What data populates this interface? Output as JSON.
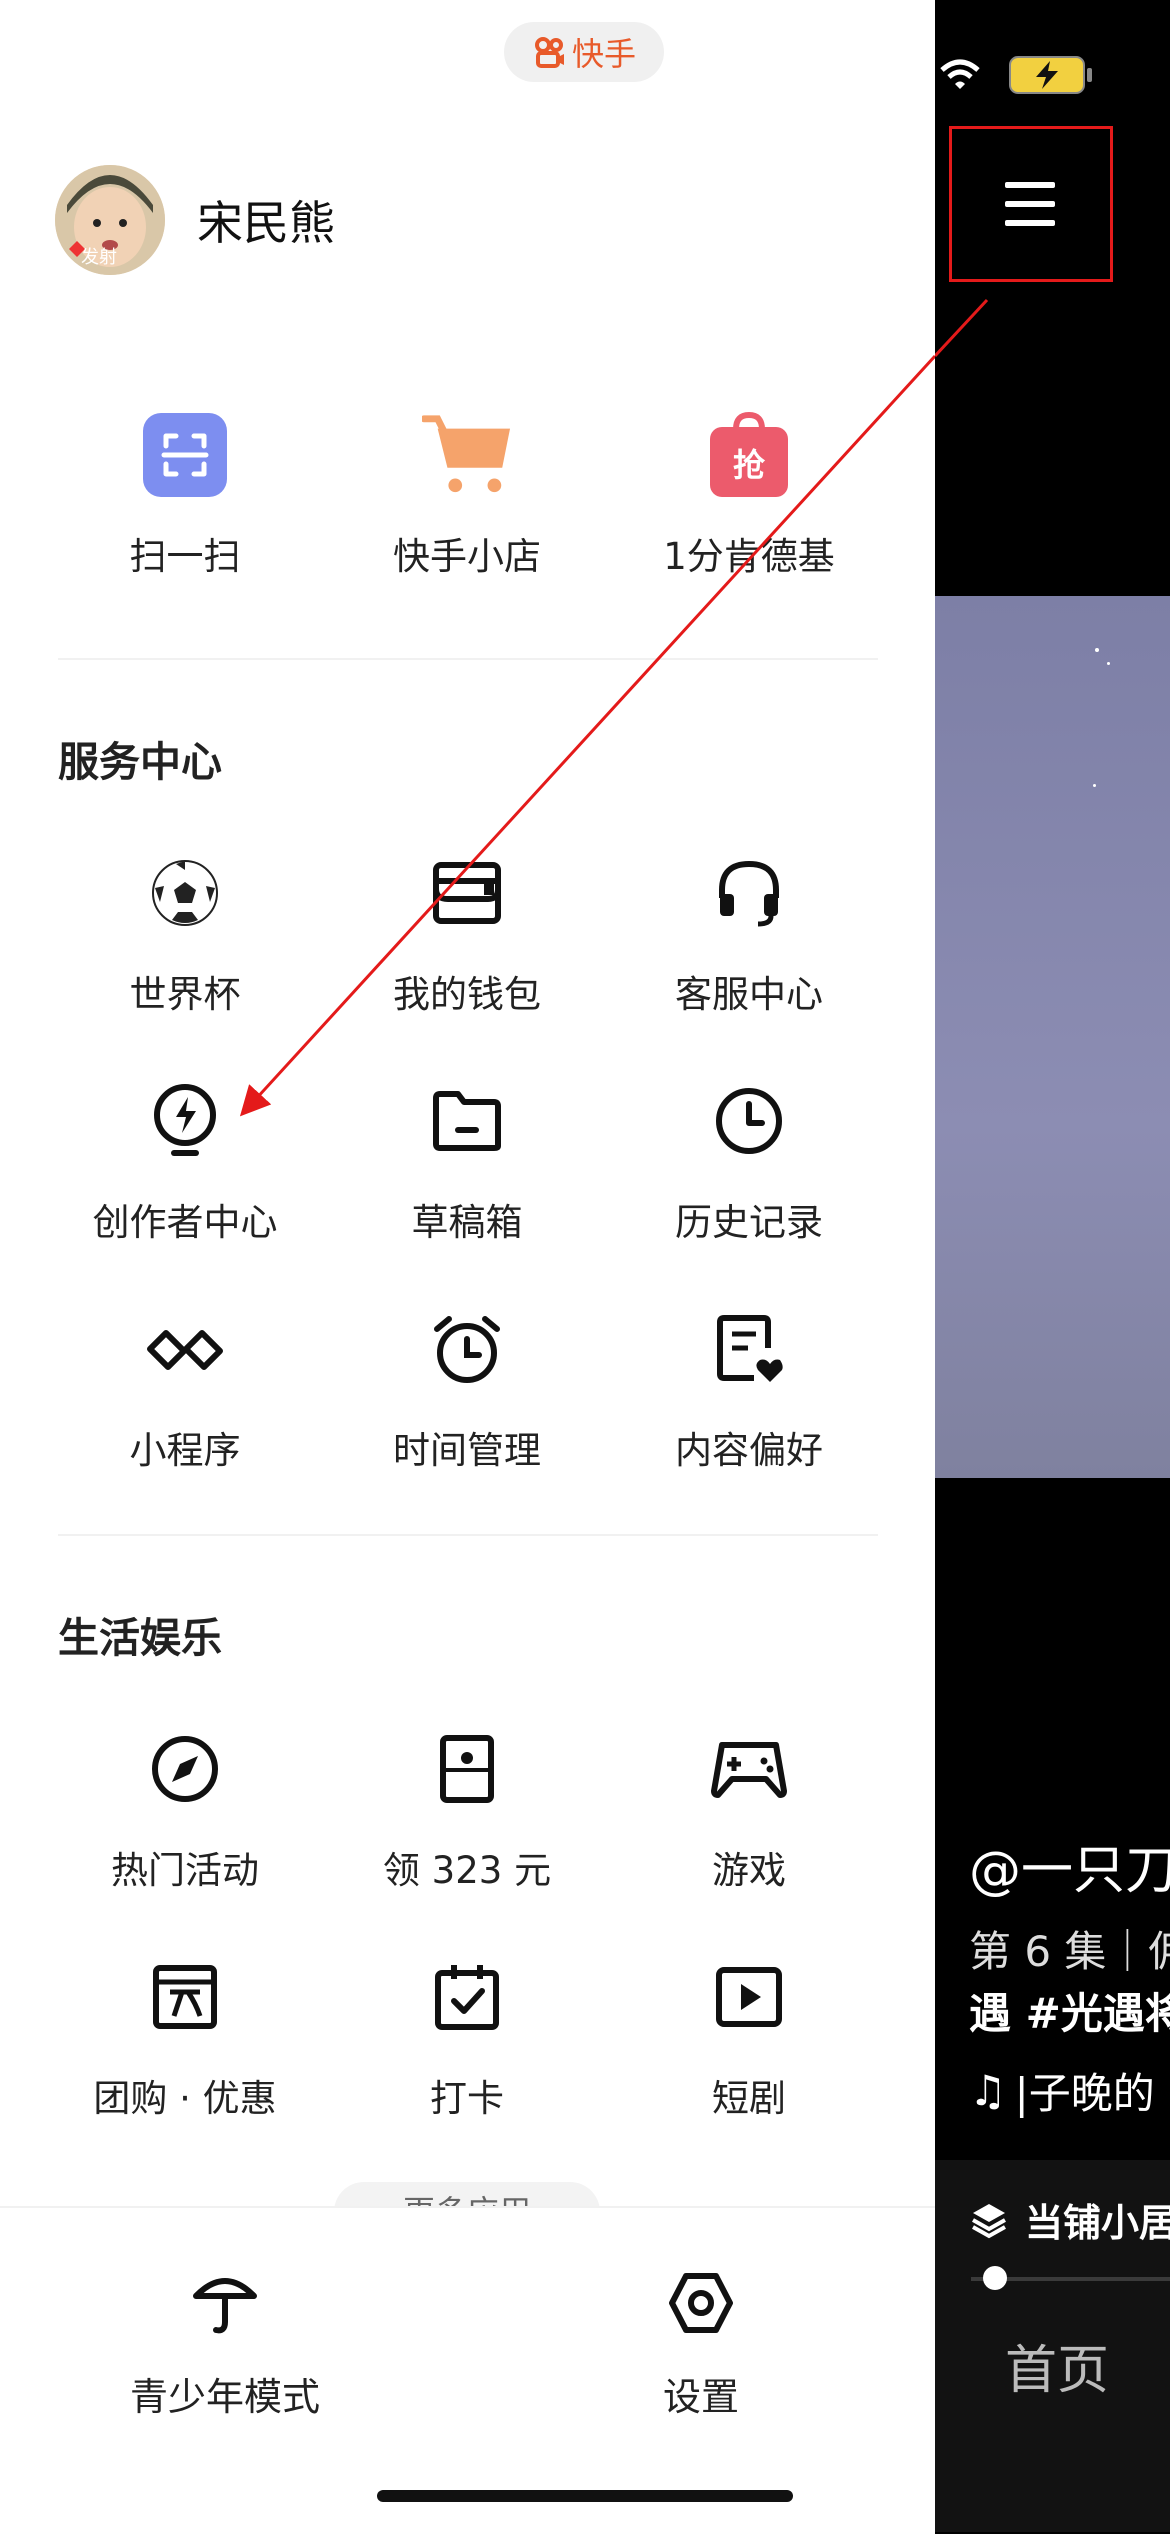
{
  "app": {
    "name": "快手"
  },
  "user": {
    "name": "宋民熊",
    "avatar_caption": "发射"
  },
  "quick": [
    {
      "label": "扫一扫",
      "icon": "scan-icon"
    },
    {
      "label": "快手小店",
      "icon": "cart-icon"
    },
    {
      "label": "1分肯德基",
      "icon": "bag-icon",
      "badge": "抢"
    }
  ],
  "service": {
    "title": "服务中心",
    "items": [
      {
        "label": "世界杯",
        "icon": "soccer-ball-icon"
      },
      {
        "label": "我的钱包",
        "icon": "wallet-icon"
      },
      {
        "label": "客服中心",
        "icon": "headset-icon"
      },
      {
        "label": "创作者中心",
        "icon": "bulb-bolt-icon"
      },
      {
        "label": "草稿箱",
        "icon": "folder-icon"
      },
      {
        "label": "历史记录",
        "icon": "clock-icon"
      },
      {
        "label": "小程序",
        "icon": "mini-program-icon"
      },
      {
        "label": "时间管理",
        "icon": "alarm-icon"
      },
      {
        "label": "内容偏好",
        "icon": "doc-heart-icon"
      }
    ]
  },
  "life": {
    "title": "生活娱乐",
    "items": [
      {
        "label": "热门活动",
        "icon": "compass-icon"
      },
      {
        "label": "领 323 元",
        "icon": "card-icon"
      },
      {
        "label": "游戏",
        "icon": "gamepad-icon"
      },
      {
        "label": "团购 · 优惠",
        "icon": "shop-icon"
      },
      {
        "label": "打卡",
        "icon": "calendar-check-icon"
      },
      {
        "label": "短剧",
        "icon": "play-icon"
      }
    ]
  },
  "more_apps": "更多应用",
  "bottom": [
    {
      "label": "青少年模式",
      "icon": "umbrella-icon"
    },
    {
      "label": "设置",
      "icon": "settings-icon"
    }
  ],
  "video": {
    "author": "@一只刀",
    "line1": "第 6 集｜佣",
    "line2": "遇 #光遇将",
    "music": "|子晚的",
    "shop": "当铺小居",
    "nav_home": "首页"
  },
  "colors": {
    "accent": "#e85a2a",
    "scan": "#7d8ef0",
    "cart": "#f5a36b",
    "bag": "#ec5b6c",
    "highlight": "#e41a1a"
  }
}
